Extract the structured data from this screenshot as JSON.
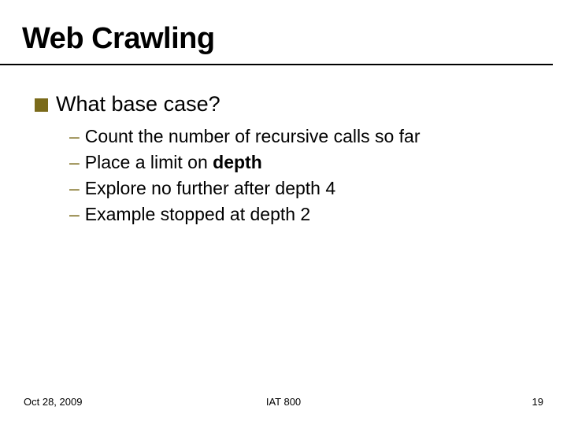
{
  "title": "Web Crawling",
  "l1": {
    "text": "What base case?"
  },
  "l2": [
    {
      "pre": "Count the number of recursive calls so far",
      "bold": "",
      "post": ""
    },
    {
      "pre": "Place a limit on ",
      "bold": "depth",
      "post": ""
    },
    {
      "pre": "Explore no further after depth 4",
      "bold": "",
      "post": ""
    },
    {
      "pre": "Example stopped at depth 2",
      "bold": "",
      "post": ""
    }
  ],
  "footer": {
    "date": "Oct 28, 2009",
    "center": "IAT 800",
    "pagenum": "19"
  },
  "colors": {
    "accent": "#7a6a1a"
  }
}
